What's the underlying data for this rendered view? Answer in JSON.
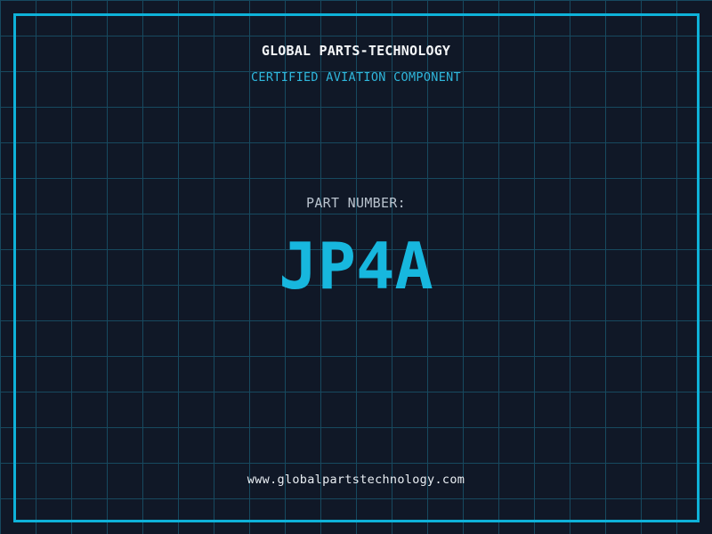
{
  "colors": {
    "bg": "#101827",
    "grid": "#17495f",
    "frame": "#0eb2d9",
    "brand": "#f4f6f8",
    "subtitle": "#2fb7dc",
    "part-label": "#b9c3ce",
    "part-number": "#17b7de",
    "url": "#e9eef3"
  },
  "header": {
    "brand": "GLOBAL PARTS-TECHNOLOGY",
    "subtitle": "CERTIFIED AVIATION COMPONENT"
  },
  "part": {
    "label": "PART NUMBER:",
    "number": "JP4A"
  },
  "footer": {
    "url": "www.globalpartstechnology.com"
  }
}
